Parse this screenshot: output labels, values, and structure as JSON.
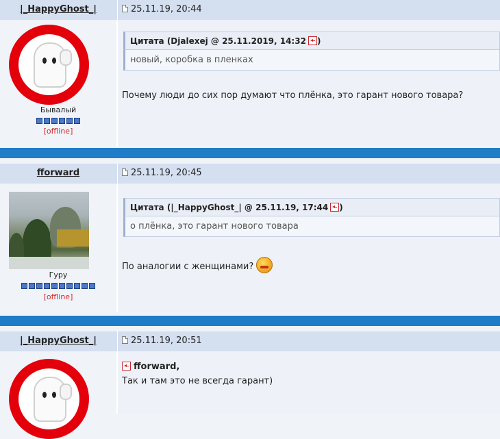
{
  "posts": [
    {
      "author": "|_HappyGhost_|",
      "date": "25.11.19, 20:44",
      "rank": "Бывалый",
      "status": "[offline]",
      "pips": 6,
      "quote_title": "Цитата (Djalexej @ 25.11.2019, 14:32",
      "quote_title_end": ")",
      "quote_text": "новый, коробка в пленках",
      "message": "Почему люди до сих пор думают что плёнка, это гарант нового товара?"
    },
    {
      "author": "fforward",
      "date": "25.11.19, 20:45",
      "rank": "Гуру",
      "status": "[offline]",
      "pips": 10,
      "quote_title": "Цитата (|_HappyGhost_| @ 25.11.19, 17:44",
      "quote_title_end": ")",
      "quote_text": "о плёнка, это гарант нового товара",
      "message": "По аналогии с женщинами?"
    },
    {
      "author": "|_HappyGhost_|",
      "date": "25.11.19, 20:51",
      "reply_to": "fforward,",
      "message": "Так и там это не всегда гарант)"
    }
  ],
  "colors": {
    "header_bg": "#d4dff0",
    "separator": "#1f7cc6",
    "offline": "#d12b2b",
    "pip": "#4b79c7"
  }
}
